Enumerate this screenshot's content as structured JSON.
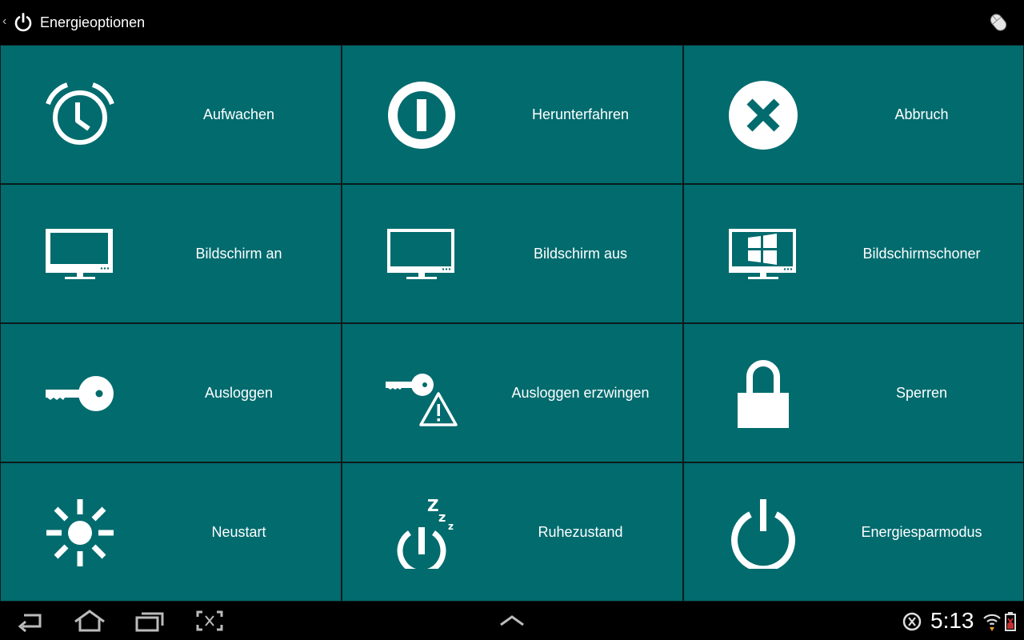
{
  "app": {
    "title": "Energieoptionen",
    "icon": "power-icon"
  },
  "topbar": {
    "mouse_icon": "mouse-icon",
    "back_icon": "chevron-left-icon"
  },
  "colors": {
    "tile": "#016b6e",
    "tile_border": "#0b1b1c",
    "background": "#000000",
    "text": "#ffffff"
  },
  "tiles": [
    {
      "label": "Aufwachen",
      "icon": "alarm-clock-icon"
    },
    {
      "label": "Herunterfahren",
      "icon": "shutdown-icon"
    },
    {
      "label": "Abbruch",
      "icon": "cancel-icon"
    },
    {
      "label": "Bildschirm an",
      "icon": "monitor-on-icon"
    },
    {
      "label": "Bildschirm aus",
      "icon": "monitor-off-icon"
    },
    {
      "label": "Bildschirmschoner",
      "icon": "screensaver-icon"
    },
    {
      "label": "Ausloggen",
      "icon": "key-icon"
    },
    {
      "label": "Ausloggen erzwingen",
      "icon": "key-warning-icon"
    },
    {
      "label": "Sperren",
      "icon": "lock-icon"
    },
    {
      "label": "Neustart",
      "icon": "restart-icon"
    },
    {
      "label": "Ruhezustand",
      "icon": "hibernate-icon"
    },
    {
      "label": "Energiesparmodus",
      "icon": "standby-icon"
    }
  ],
  "statusbar": {
    "time": "5:13"
  }
}
